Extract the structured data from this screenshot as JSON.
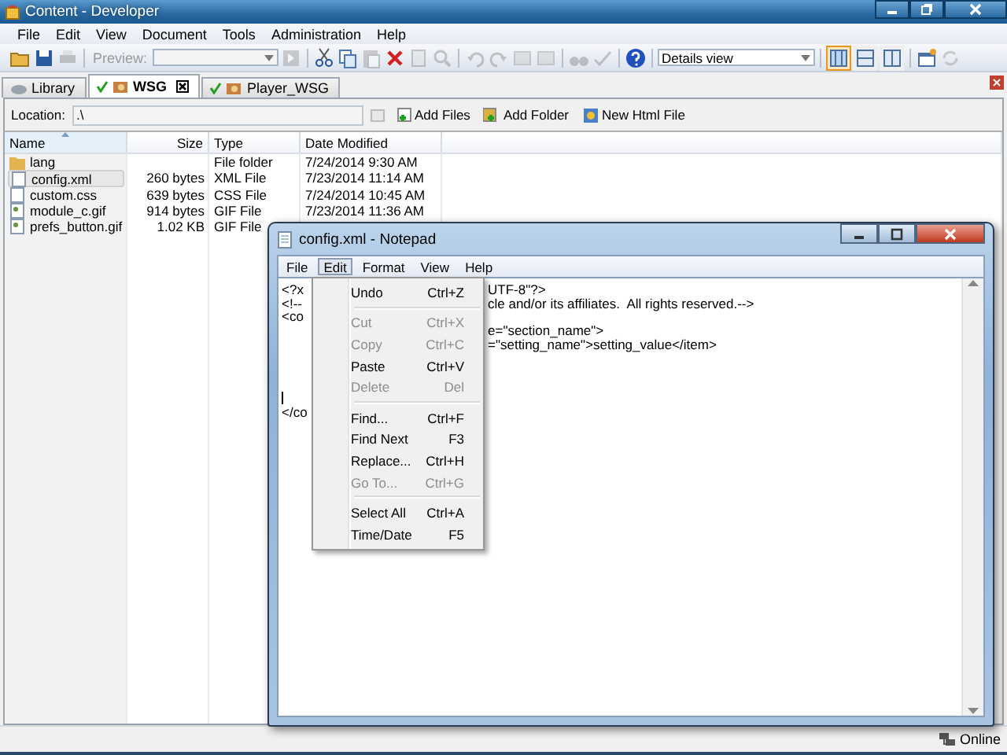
{
  "window": {
    "title": "Content - Developer"
  },
  "menu": [
    "File",
    "Edit",
    "View",
    "Document",
    "Tools",
    "Administration",
    "Help"
  ],
  "toolbar": {
    "icons": [
      {
        "disabled": false
      },
      {
        "disabled": false
      },
      {
        "disabled": true
      }
    ],
    "preview": {
      "label": "Preview:",
      "disabled": true
    },
    "icons_after": [
      {
        "disabled": true
      },
      {
        "disabled": false
      },
      {
        "disabled": false
      },
      {
        "disabled": true
      },
      {
        "disabled": false
      },
      {
        "disabled": true
      },
      {
        "disabled": true
      },
      {
        "disabled": true
      },
      {
        "disabled": true
      },
      {
        "disabled": true
      },
      {
        "disabled": true
      },
      {
        "disabled": true
      },
      {
        "disabled": true
      },
      {
        "disabled": false
      }
    ],
    "view_select": "Details view",
    "view_buttons": [
      {
        "selected": true
      },
      {
        "selected": false
      },
      {
        "selected": false
      }
    ],
    "extra_icons": [
      {
        "disabled": false
      },
      {
        "disabled": true
      }
    ]
  },
  "tabs": [
    {
      "label": "Library",
      "selected": false,
      "checked": false,
      "closable": false
    },
    {
      "label": "WSG",
      "selected": true,
      "checked": true,
      "closable": true
    },
    {
      "label": "Player_WSG",
      "selected": false,
      "checked": true,
      "closable": false
    }
  ],
  "location": {
    "label": "Location:",
    "value": ".\\"
  },
  "actions": [
    "Add Files",
    "Add Folder",
    "New Html File"
  ],
  "table": {
    "columns": [
      "Name",
      "Size",
      "Type",
      "Date Modified"
    ],
    "rows": [
      {
        "kind": "folder",
        "name": "lang",
        "type": "File folder",
        "date": "7/24/2014 9:30 AM",
        "selected": false
      },
      {
        "kind": "file",
        "name": "config.xml",
        "size": "260 bytes",
        "type": "XML File",
        "date": "7/23/2014 11:14 AM",
        "selected": true
      },
      {
        "kind": "file",
        "name": "custom.css",
        "size": "639 bytes",
        "type": "CSS File",
        "date": "7/24/2014 10:45 AM",
        "selected": false
      },
      {
        "kind": "image",
        "name": "module_c.gif",
        "size": "914 bytes",
        "type": "GIF File",
        "date": "7/23/2014 11:36 AM",
        "selected": false
      },
      {
        "kind": "image",
        "name": "prefs_button.gif",
        "size": "1.02 KB",
        "type": "GIF File",
        "selected": false
      }
    ]
  },
  "status_bar": {
    "text": "Online"
  },
  "notepad": {
    "title": "config.xml - Notepad",
    "menu": [
      {
        "label": "File",
        "selected": false
      },
      {
        "label": "Edit",
        "selected": true
      },
      {
        "label": "Format",
        "selected": false
      },
      {
        "label": "View",
        "selected": false
      },
      {
        "label": "Help",
        "selected": false
      }
    ],
    "lines": [
      {
        "left": "<?x",
        "right": "UTF-8\"?>"
      },
      {
        "left": "<!--",
        "right": "cle and/or its affiliates.  All rights reserved.-->"
      },
      {
        "left": "<co"
      },
      {
        "right": "e=\"section_name\">"
      },
      {
        "right": "=\"setting_name\">setting_value</item>"
      },
      {
        "caret": true
      },
      {
        "left": "</co"
      }
    ],
    "dropdown": [
      {
        "kind": "item",
        "label": "Undo",
        "shortcut": "Ctrl+Z",
        "disabled": false
      },
      {
        "kind": "separator"
      },
      {
        "kind": "item",
        "label": "Cut",
        "shortcut": "Ctrl+X",
        "disabled": true
      },
      {
        "kind": "item",
        "label": "Copy",
        "shortcut": "Ctrl+C",
        "disabled": true
      },
      {
        "kind": "item",
        "label": "Paste",
        "shortcut": "Ctrl+V",
        "disabled": false
      },
      {
        "kind": "item",
        "label": "Delete",
        "shortcut": "Del",
        "disabled": true
      },
      {
        "kind": "separator"
      },
      {
        "kind": "item",
        "label": "Find...",
        "shortcut": "Ctrl+F",
        "disabled": false
      },
      {
        "kind": "item",
        "label": "Find Next",
        "shortcut": "F3",
        "disabled": false
      },
      {
        "kind": "item",
        "label": "Replace...",
        "shortcut": "Ctrl+H",
        "disabled": false
      },
      {
        "kind": "item",
        "label": "Go To...",
        "shortcut": "Ctrl+G",
        "disabled": true
      },
      {
        "kind": "separator"
      },
      {
        "kind": "item",
        "label": "Select All",
        "shortcut": "Ctrl+A",
        "disabled": false
      },
      {
        "kind": "item",
        "label": "Time/Date",
        "shortcut": "F5",
        "disabled": false
      }
    ]
  }
}
